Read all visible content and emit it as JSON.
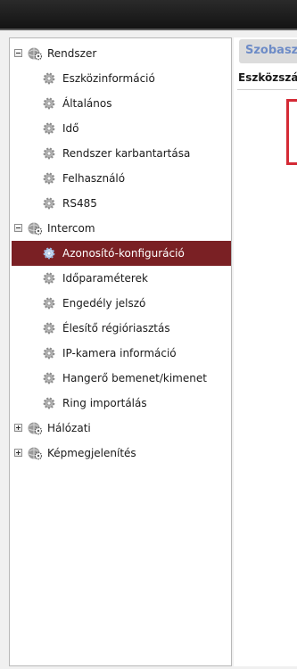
{
  "tree": {
    "groups": [
      {
        "label": "Rendszer",
        "expanded": true,
        "items": [
          "Eszközinformáció",
          "Általános",
          "Idő",
          "Rendszer karbantartása",
          "Felhasználó",
          "RS485"
        ]
      },
      {
        "label": "Intercom",
        "expanded": true,
        "items": [
          "Azonosító-konfiguráció",
          "Időparaméterek",
          "Engedély jelszó",
          "Élesítő régióriasztás",
          "IP-kamera információ",
          "Hangerő bemenet/kimenet",
          "Ring importálás"
        ]
      },
      {
        "label": "Hálózati",
        "expanded": false,
        "items": []
      },
      {
        "label": "Képmegjelenítés",
        "expanded": false,
        "items": []
      }
    ],
    "selected": "Azonosító-konfiguráció"
  },
  "content": {
    "header_title": "Szobasz",
    "field_label": "Eszközszám"
  },
  "colors": {
    "selected_bg": "#7a2024",
    "header_text": "#6e8cc7",
    "highlight_box": "#d42a35"
  },
  "icons": {
    "group": "globe-gear-icon",
    "item": "gear-icon",
    "expanded": "minus-box-icon",
    "collapsed": "plus-box-icon"
  }
}
